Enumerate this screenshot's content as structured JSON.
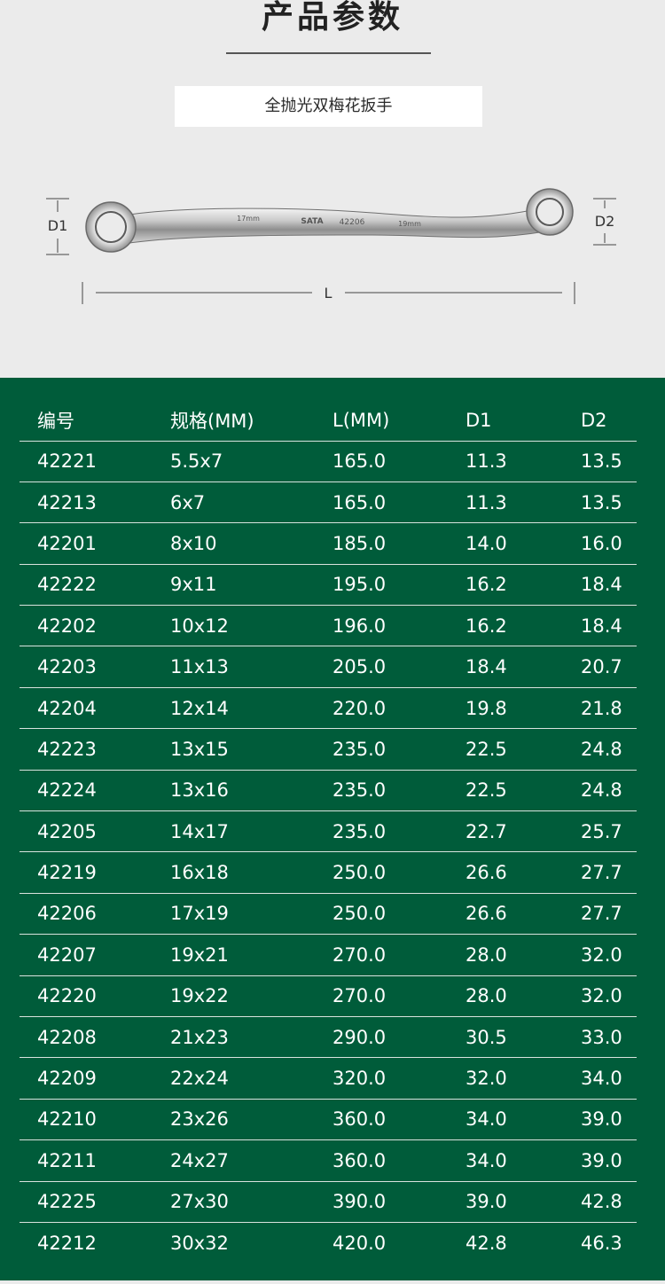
{
  "header": {
    "title": "产品参数",
    "product_name": "全抛光双梅花扳手"
  },
  "diagram": {
    "label_d1": "D1",
    "label_d2": "D2",
    "label_l": "L",
    "engraving_left": "17mm",
    "engraving_brand": "SATA",
    "engraving_model": "42206",
    "engraving_right": "19mm"
  },
  "table": {
    "headers": [
      "编号",
      "规格(MM)",
      "L(MM)",
      "D1",
      "D2"
    ],
    "rows": [
      [
        "42221",
        "5.5x7",
        "165.0",
        "11.3",
        "13.5"
      ],
      [
        "42213",
        "6x7",
        "165.0",
        "11.3",
        "13.5"
      ],
      [
        "42201",
        "8x10",
        "185.0",
        "14.0",
        "16.0"
      ],
      [
        "42222",
        "9x11",
        "195.0",
        "16.2",
        "18.4"
      ],
      [
        "42202",
        "10x12",
        "196.0",
        "16.2",
        "18.4"
      ],
      [
        "42203",
        "11x13",
        "205.0",
        "18.4",
        "20.7"
      ],
      [
        "42204",
        "12x14",
        "220.0",
        "19.8",
        "21.8"
      ],
      [
        "42223",
        "13x15",
        "235.0",
        "22.5",
        "24.8"
      ],
      [
        "42224",
        "13x16",
        "235.0",
        "22.5",
        "24.8"
      ],
      [
        "42205",
        "14x17",
        "235.0",
        "22.7",
        "25.7"
      ],
      [
        "42219",
        "16x18",
        "250.0",
        "26.6",
        "27.7"
      ],
      [
        "42206",
        "17x19",
        "250.0",
        "26.6",
        "27.7"
      ],
      [
        "42207",
        "19x21",
        "270.0",
        "28.0",
        "32.0"
      ],
      [
        "42220",
        "19x22",
        "270.0",
        "28.0",
        "32.0"
      ],
      [
        "42208",
        "21x23",
        "290.0",
        "30.5",
        "33.0"
      ],
      [
        "42209",
        "22x24",
        "320.0",
        "32.0",
        "34.0"
      ],
      [
        "42210",
        "23x26",
        "360.0",
        "34.0",
        "39.0"
      ],
      [
        "42211",
        "24x27",
        "360.0",
        "34.0",
        "39.0"
      ],
      [
        "42225",
        "27x30",
        "390.0",
        "39.0",
        "42.8"
      ],
      [
        "42212",
        "30x32",
        "420.0",
        "42.8",
        "46.3"
      ]
    ]
  },
  "colors": {
    "panel_bg": "#ebebeb",
    "table_bg": "#005c3a",
    "text_light": "#ffffff",
    "title_text": "#222222"
  }
}
